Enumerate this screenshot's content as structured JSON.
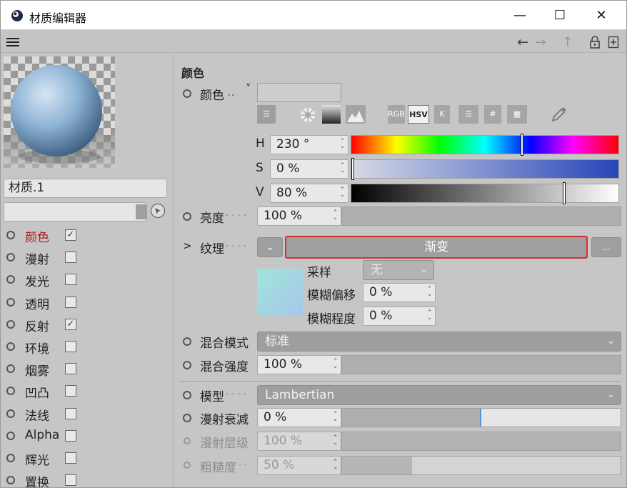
{
  "window": {
    "title": "材质编辑器",
    "controls": {
      "minimize": "—",
      "maximize": "☐",
      "close": "✕"
    }
  },
  "menubar": {
    "menu_icon": "hamburger-icon",
    "nav": {
      "back": "←",
      "forward": "→",
      "up": "↑"
    }
  },
  "left": {
    "material_name": "材质.1",
    "channels": [
      {
        "label": "颜色",
        "checked": true,
        "mark": "✓",
        "active": true
      },
      {
        "label": "漫射",
        "checked": false,
        "mark": ""
      },
      {
        "label": "发光",
        "checked": false,
        "mark": ""
      },
      {
        "label": "透明",
        "checked": false,
        "mark": ""
      },
      {
        "label": "反射",
        "checked": true,
        "mark": "✓"
      },
      {
        "label": "环境",
        "checked": false,
        "mark": ""
      },
      {
        "label": "烟雾",
        "checked": false,
        "mark": ""
      },
      {
        "label": "凹凸",
        "checked": false,
        "mark": ""
      },
      {
        "label": "法线",
        "checked": false,
        "mark": ""
      },
      {
        "label": "Alpha",
        "checked": false,
        "mark": ""
      },
      {
        "label": "辉光",
        "checked": false,
        "mark": ""
      },
      {
        "label": "置换",
        "checked": false,
        "mark": ""
      }
    ]
  },
  "color": {
    "section_title": "颜色",
    "color_label": "颜色",
    "color_dots": "..",
    "arrow": "˅",
    "modes": {
      "rgb": "RGB",
      "hsv": "HSV",
      "k": "K",
      "hash": "#"
    },
    "h": {
      "label": "H",
      "value": "230 °",
      "fraction": 0.64
    },
    "s": {
      "label": "S",
      "value": "0 %",
      "fraction": 0.0
    },
    "v": {
      "label": "V",
      "value": "80 %",
      "fraction": 0.8
    },
    "brightness": {
      "label": "亮度",
      "dots": ". . . .",
      "value": "100 %",
      "fraction": 1.0
    },
    "texture": {
      "label": "纹理",
      "dots": ". . . .",
      "expander": ">",
      "name": "渐变",
      "more": "..."
    },
    "sampling": {
      "label": "采样",
      "value": "无"
    },
    "blur_offset": {
      "label": "模糊偏移",
      "value": "0 %"
    },
    "blur_amount": {
      "label": "模糊程度",
      "value": "0 %"
    },
    "blend_mode": {
      "label": "混合模式",
      "value": "标准"
    },
    "blend_strength": {
      "label": "混合强度",
      "value": "100 %",
      "fraction": 1.0
    }
  },
  "model": {
    "model": {
      "label": "模型",
      "dots": ". . . .",
      "value": "Lambertian"
    },
    "diffuse_falloff": {
      "label": "漫射衰减",
      "value": "0 %",
      "fraction": 0.5
    },
    "diffuse_level": {
      "label": "漫射层级",
      "value": "100 %",
      "fraction": 1.0
    },
    "roughness": {
      "label": "粗糙度",
      "dots": ". .",
      "value": "50 %",
      "fraction": 0.25
    }
  },
  "accent": {
    "texture_outline": "#d03030",
    "hue_marker": "#111111"
  }
}
